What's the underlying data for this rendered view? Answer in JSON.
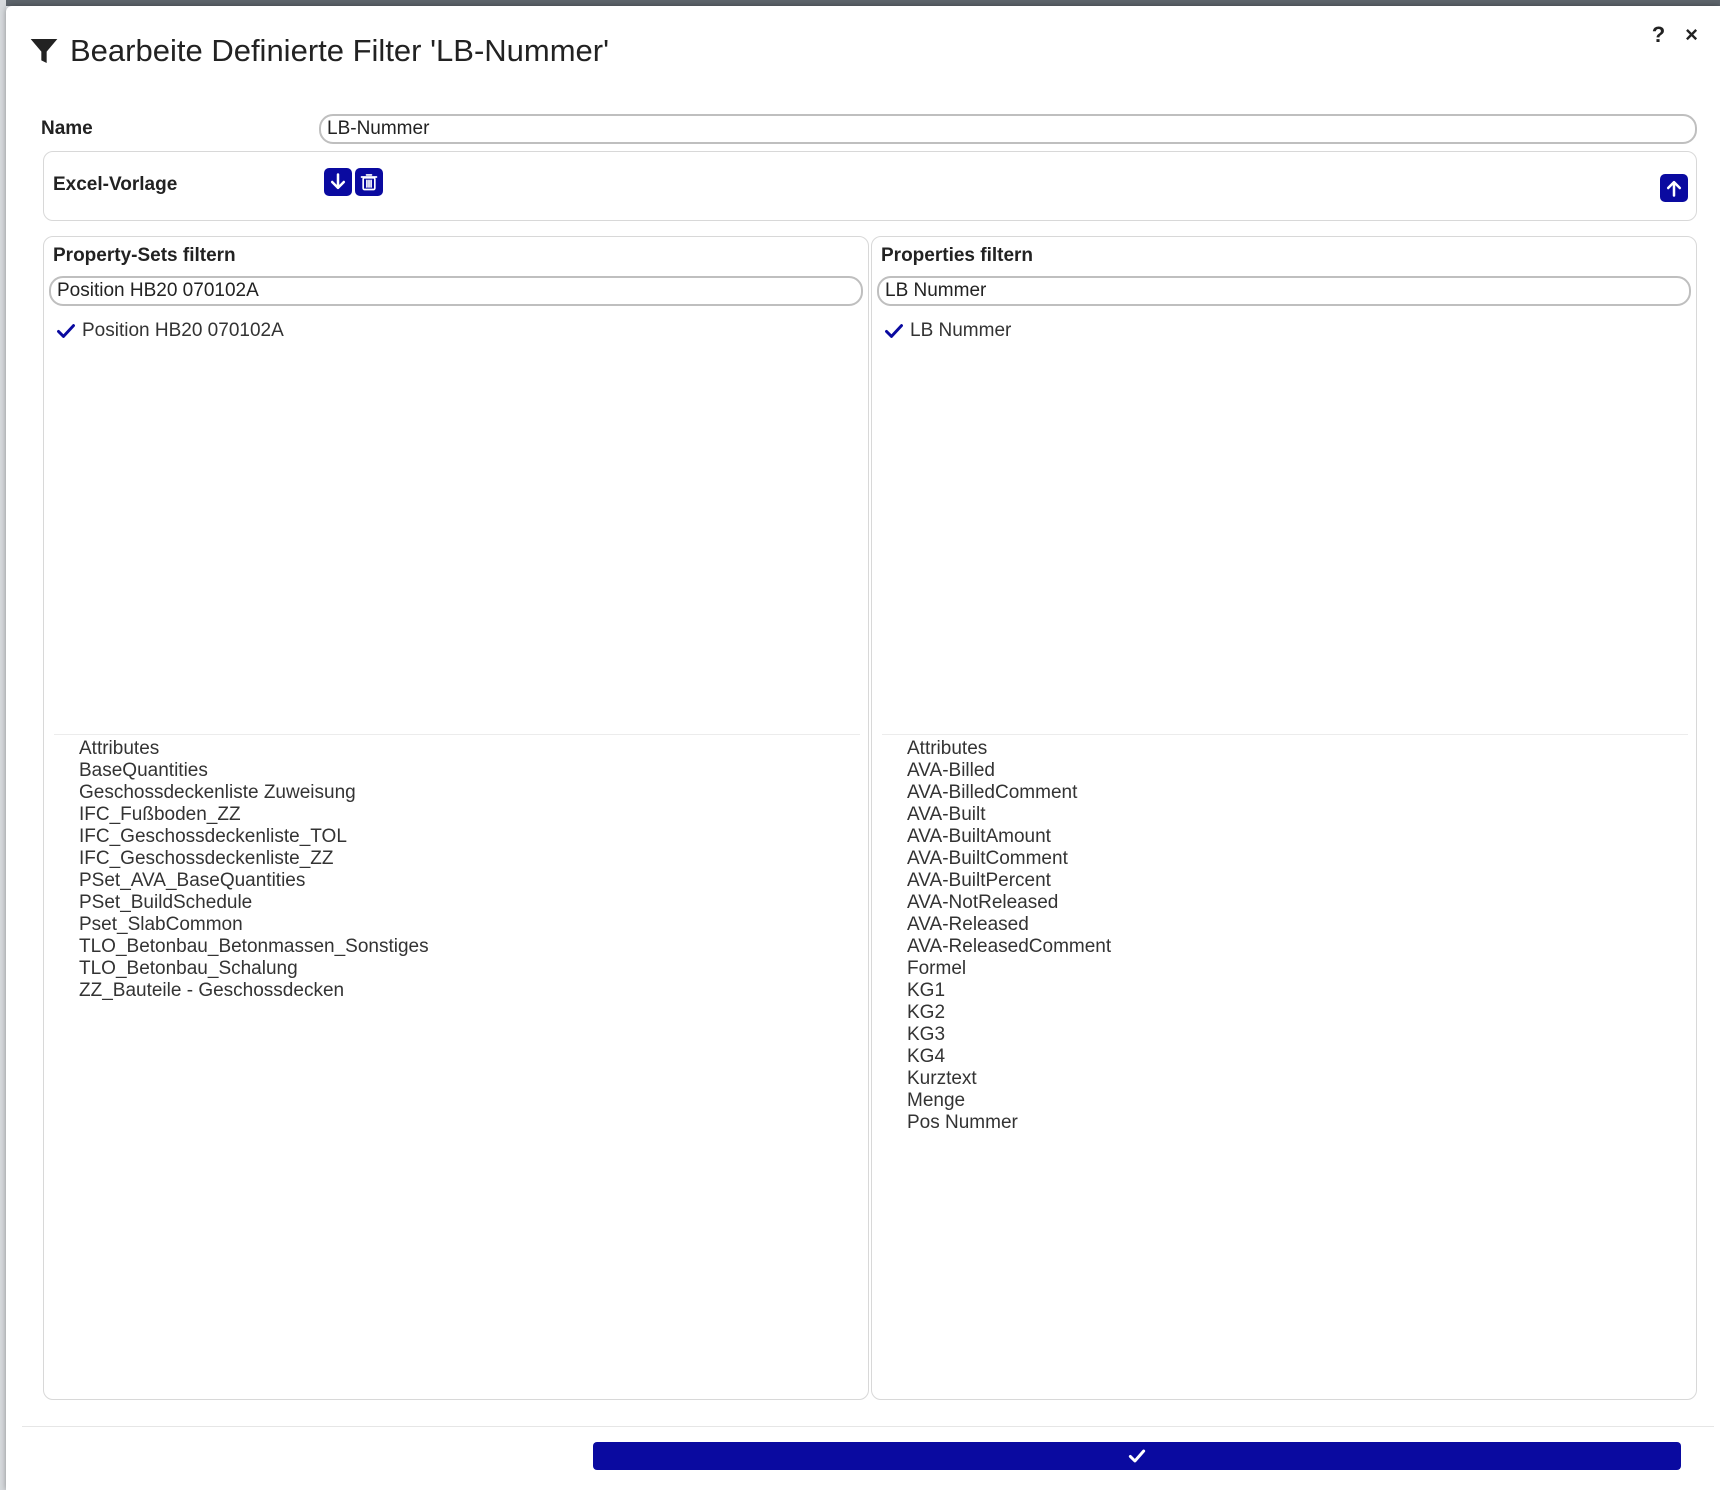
{
  "dialog": {
    "title": "Bearbeite Definierte Filter 'LB-Nummer'",
    "help_label": "?",
    "close_label": "×"
  },
  "name_row": {
    "label": "Name",
    "value": "LB-Nummer"
  },
  "excel": {
    "label": "Excel-Vorlage",
    "download_icon": "arrow-down-icon",
    "delete_icon": "trash-icon",
    "upload_icon": "arrow-up-icon"
  },
  "property_sets": {
    "title": "Property-Sets filtern",
    "search_value": "Position HB20 070102A",
    "selected": "Position HB20 070102A",
    "items": [
      "Attributes",
      "BaseQuantities",
      "Geschossdeckenliste Zuweisung",
      "IFC_Fußboden_ZZ",
      "IFC_Geschossdeckenliste_TOL",
      "IFC_Geschossdeckenliste_ZZ",
      "PSet_AVA_BaseQuantities",
      "PSet_BuildSchedule",
      "Pset_SlabCommon",
      "TLO_Betonbau_Betonmassen_Sonstiges",
      "TLO_Betonbau_Schalung",
      "ZZ_Bauteile - Geschossdecken"
    ]
  },
  "properties": {
    "title": "Properties filtern",
    "search_value": "LB Nummer",
    "selected": "LB Nummer",
    "items": [
      "Attributes",
      "AVA-Billed",
      "AVA-BilledComment",
      "AVA-Built",
      "AVA-BuiltAmount",
      "AVA-BuiltComment",
      "AVA-BuiltPercent",
      "AVA-NotReleased",
      "AVA-Released",
      "AVA-ReleasedComment",
      "Formel",
      "KG1",
      "KG2",
      "KG3",
      "KG4",
      "Kurztext",
      "Menge",
      "Pos Nummer"
    ]
  },
  "colors": {
    "accent": "#0a0aa0",
    "text": "#333333"
  }
}
